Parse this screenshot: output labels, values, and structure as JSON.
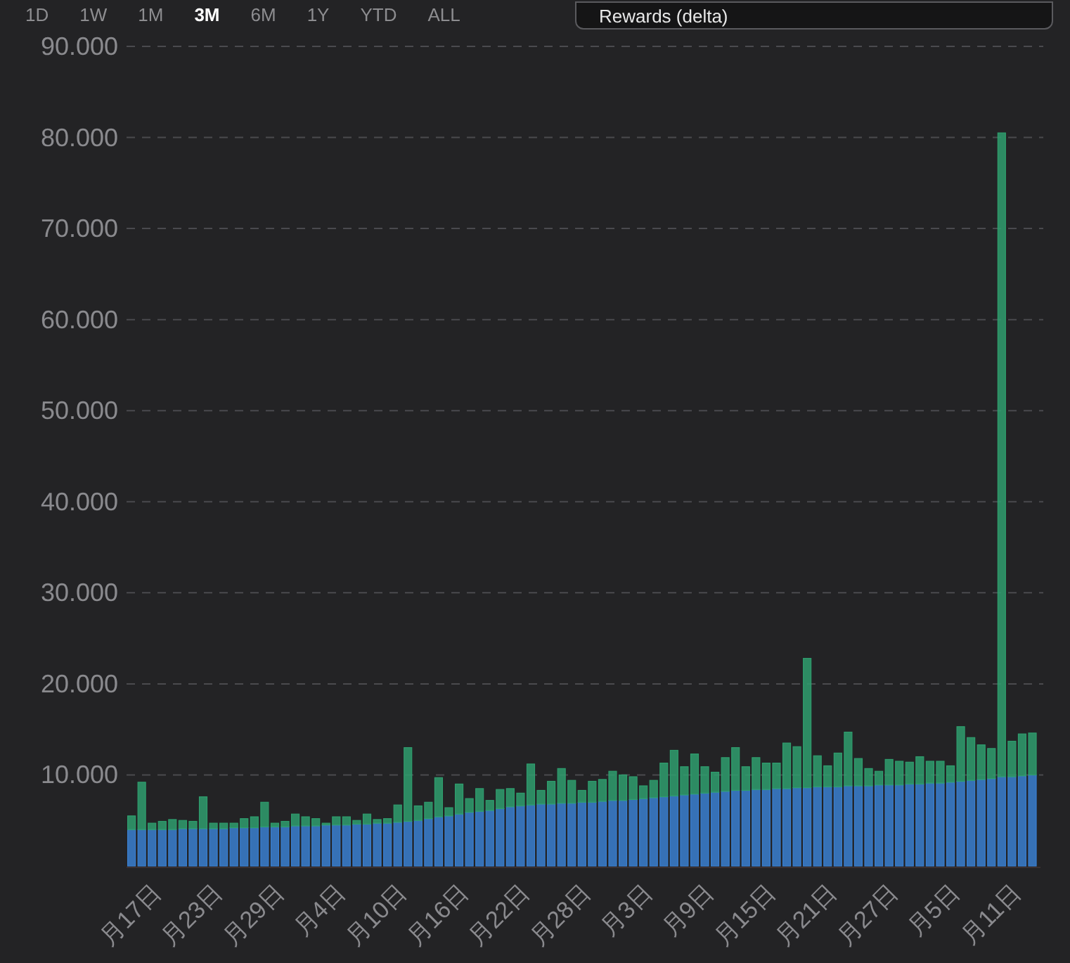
{
  "toolbar": {
    "tabs": [
      {
        "label": "1D",
        "selected": false
      },
      {
        "label": "1W",
        "selected": false
      },
      {
        "label": "1M",
        "selected": false
      },
      {
        "label": "3M",
        "selected": true
      },
      {
        "label": "6M",
        "selected": false
      },
      {
        "label": "1Y",
        "selected": false
      },
      {
        "label": "YTD",
        "selected": false
      },
      {
        "label": "ALL",
        "selected": false
      }
    ],
    "dropdown": {
      "value": "Rewards (delta)"
    }
  },
  "chart": {
    "chart_data": {
      "type": "bar",
      "stacked": true,
      "grid": true,
      "ylim": [
        0,
        90000
      ],
      "categories": [
        null,
        null,
        null,
        "月17日",
        null,
        null,
        null,
        null,
        null,
        "月23日",
        null,
        null,
        null,
        null,
        null,
        "月29日",
        null,
        null,
        null,
        null,
        null,
        "月4日",
        null,
        null,
        null,
        null,
        null,
        "月10日",
        null,
        null,
        null,
        null,
        null,
        "月16日",
        null,
        null,
        null,
        null,
        null,
        "月22日",
        null,
        null,
        null,
        null,
        null,
        "月28日",
        null,
        null,
        null,
        null,
        null,
        "月3日",
        null,
        null,
        null,
        null,
        null,
        "月9日",
        null,
        null,
        null,
        null,
        null,
        "月15日",
        null,
        null,
        null,
        null,
        null,
        "月21日",
        null,
        null,
        null,
        null,
        null,
        "月27日",
        null,
        null,
        null,
        null,
        null,
        "月5日",
        null,
        null,
        null,
        null,
        null,
        "月11日",
        null
      ],
      "yticks": [
        {
          "value": 10000,
          "label": "10.000"
        },
        {
          "value": 20000,
          "label": "20.000"
        },
        {
          "value": 30000,
          "label": "30.000"
        },
        {
          "value": 40000,
          "label": "40.000"
        },
        {
          "value": 50000,
          "label": "50.000"
        },
        {
          "value": 60000,
          "label": "60.000"
        },
        {
          "value": 70000,
          "label": "70.000"
        },
        {
          "value": 80000,
          "label": "80.000"
        },
        {
          "value": 90000,
          "label": "90.000"
        }
      ],
      "series": [
        {
          "color": "#3a7fd0",
          "values": [
            4000,
            4000,
            4000,
            4000,
            4000,
            4100,
            4100,
            4100,
            4100,
            4100,
            4200,
            4200,
            4200,
            4300,
            4300,
            4300,
            4400,
            4400,
            4400,
            4500,
            4500,
            4500,
            4600,
            4600,
            4700,
            4700,
            4800,
            4900,
            5000,
            5200,
            5400,
            5500,
            5700,
            5900,
            6000,
            6100,
            6300,
            6500,
            6600,
            6700,
            6800,
            6800,
            6900,
            6900,
            7000,
            7000,
            7100,
            7200,
            7200,
            7300,
            7400,
            7500,
            7600,
            7700,
            7800,
            7900,
            8000,
            8100,
            8200,
            8300,
            8300,
            8400,
            8400,
            8500,
            8500,
            8600,
            8600,
            8700,
            8700,
            8700,
            8800,
            8800,
            8800,
            8900,
            8900,
            8900,
            9000,
            9000,
            9100,
            9100,
            9200,
            9300,
            9400,
            9500,
            9600,
            9800,
            9800,
            9900,
            10000
          ]
        },
        {
          "color": "#2f9e6e",
          "values": [
            1500,
            5200,
            700,
            900,
            1100,
            900,
            800,
            3500,
            600,
            600,
            500,
            1000,
            1200,
            2700,
            400,
            600,
            1300,
            1000,
            800,
            200,
            900,
            900,
            400,
            1100,
            400,
            500,
            1900,
            8100,
            1600,
            1800,
            4300,
            900,
            3300,
            1500,
            2500,
            1100,
            2100,
            2000,
            1400,
            4500,
            1500,
            2500,
            3800,
            2500,
            1300,
            2300,
            2400,
            3200,
            2800,
            2500,
            1400,
            1900,
            3700,
            5000,
            3100,
            4400,
            2900,
            2200,
            3700,
            4700,
            2600,
            3500,
            2900,
            2800,
            5000,
            4500,
            14200,
            3400,
            2300,
            3700,
            5900,
            3000,
            1900,
            1500,
            2800,
            2600,
            2400,
            3000,
            2400,
            2400,
            1800,
            6000,
            4700,
            3800,
            3300,
            70700,
            3900,
            4600,
            4600
          ]
        }
      ]
    }
  }
}
